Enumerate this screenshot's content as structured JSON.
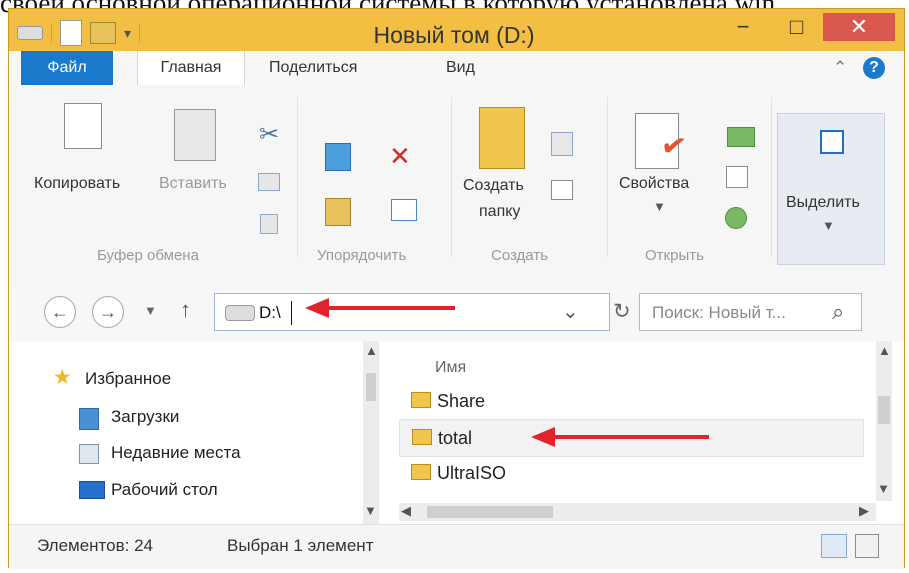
{
  "caption": {
    "text": "своей основной операционной системы в которую установлена win"
  },
  "window": {
    "title": "Новый том (D:)",
    "minimize_symbol": "−",
    "maximize_symbol": "□",
    "close_symbol": "✕"
  },
  "ribbon_tabs": [
    {
      "label": "Файл"
    },
    {
      "label": "Главная"
    },
    {
      "label": "Поделиться"
    },
    {
      "label": "Вид"
    }
  ],
  "ribbon": {
    "clipboard": {
      "copy": "Копировать",
      "paste": "Вставить",
      "label": "Буфер обмена"
    },
    "organize": {
      "label": "Упорядочить"
    },
    "create": {
      "new_folder_line1": "Создать",
      "new_folder_line2": "папку",
      "label": "Создать"
    },
    "open": {
      "properties": "Свойства",
      "label": "Открыть"
    },
    "select": {
      "label": "Выделить"
    }
  },
  "address_bar": {
    "path": "D:\\",
    "search_placeholder": "Поиск: Новый т...",
    "back_symbol": "←",
    "forward_symbol": "→",
    "up_symbol": "↑",
    "dropdown_symbol": "⌄",
    "refresh_symbol": "↻",
    "search_symbol": "⌕"
  },
  "navigation_pane": {
    "items": [
      {
        "label": "Избранное",
        "icon": "star-icon"
      },
      {
        "label": "Загрузки",
        "icon": "downloads-icon"
      },
      {
        "label": "Недавние места",
        "icon": "recent-places-icon"
      },
      {
        "label": "Рабочий стол",
        "icon": "desktop-icon"
      }
    ]
  },
  "file_list": {
    "column_header": "Имя",
    "items": [
      {
        "name": "Share",
        "icon": "folder-icon"
      },
      {
        "name": "total",
        "icon": "folder-icon",
        "selected": true
      },
      {
        "name": "UltraISO",
        "icon": "folder-icon"
      }
    ]
  },
  "status_bar": {
    "item_count": "Элементов: 24",
    "selected": "Выбран 1 элемент"
  },
  "colors": {
    "title_bar": "#f3bf42",
    "file_tab": "#1979ca",
    "close_button": "#d9574c",
    "arrow": "#e2232b"
  }
}
